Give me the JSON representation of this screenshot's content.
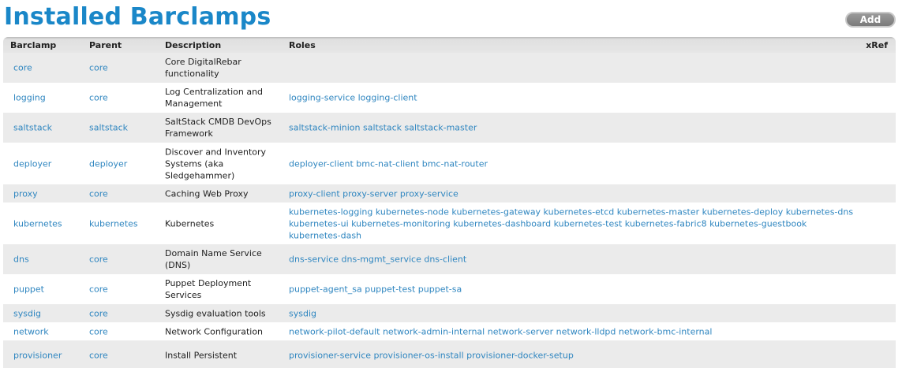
{
  "page": {
    "title": "Installed Barclamps",
    "add_label": "Add"
  },
  "table": {
    "headers": {
      "barclamp": "Barclamp",
      "parent": "Parent",
      "description": "Description",
      "roles": "Roles",
      "xref": "xRef"
    },
    "rows": [
      {
        "barclamp": "core",
        "parent": "core",
        "description": "Core DigitalRebar functionality",
        "roles": ""
      },
      {
        "barclamp": "logging",
        "parent": "core",
        "description": "Log Centralization and Management",
        "roles": "logging-service logging-client"
      },
      {
        "barclamp": "saltstack",
        "parent": "saltstack",
        "description": "SaltStack CMDB DevOps Framework",
        "roles": "saltstack-minion saltstack saltstack-master"
      },
      {
        "barclamp": "deployer",
        "parent": "deployer",
        "description": "Discover and Inventory Systems (aka Sledgehammer)",
        "roles": "deployer-client bmc-nat-client bmc-nat-router"
      },
      {
        "barclamp": "proxy",
        "parent": "core",
        "description": "Caching Web Proxy",
        "roles": "proxy-client proxy-server proxy-service"
      },
      {
        "barclamp": "kubernetes",
        "parent": "kubernetes",
        "description": "Kubernetes",
        "roles": "kubernetes-logging kubernetes-node kubernetes-gateway kubernetes-etcd kubernetes-master kubernetes-deploy kubernetes-dns kubernetes-ui kubernetes-monitoring kubernetes-dashboard kubernetes-test kubernetes-fabric8 kubernetes-guestbook kubernetes-dash"
      },
      {
        "barclamp": "dns",
        "parent": "core",
        "description": "Domain Name Service (DNS)",
        "roles": "dns-service dns-mgmt_service dns-client"
      },
      {
        "barclamp": "puppet",
        "parent": "core",
        "description": "Puppet Deployment Services",
        "roles": "puppet-agent_sa puppet-test puppet-sa"
      },
      {
        "barclamp": "sysdig",
        "parent": "core",
        "description": "Sysdig evaluation tools",
        "roles": "sysdig"
      },
      {
        "barclamp": "network",
        "parent": "core",
        "description": "Network Configuration",
        "roles": "network-pilot-default network-admin-internal network-server network-lldpd network-bmc-internal"
      },
      {
        "barclamp": "provisioner",
        "parent": "core",
        "description": "Install Persistent",
        "roles": "provisioner-service provisioner-os-install provisioner-docker-setup"
      }
    ]
  },
  "colors": {
    "title": "#1a87c8",
    "link": "#2f86c0",
    "row_alt": "#ebebeb"
  }
}
